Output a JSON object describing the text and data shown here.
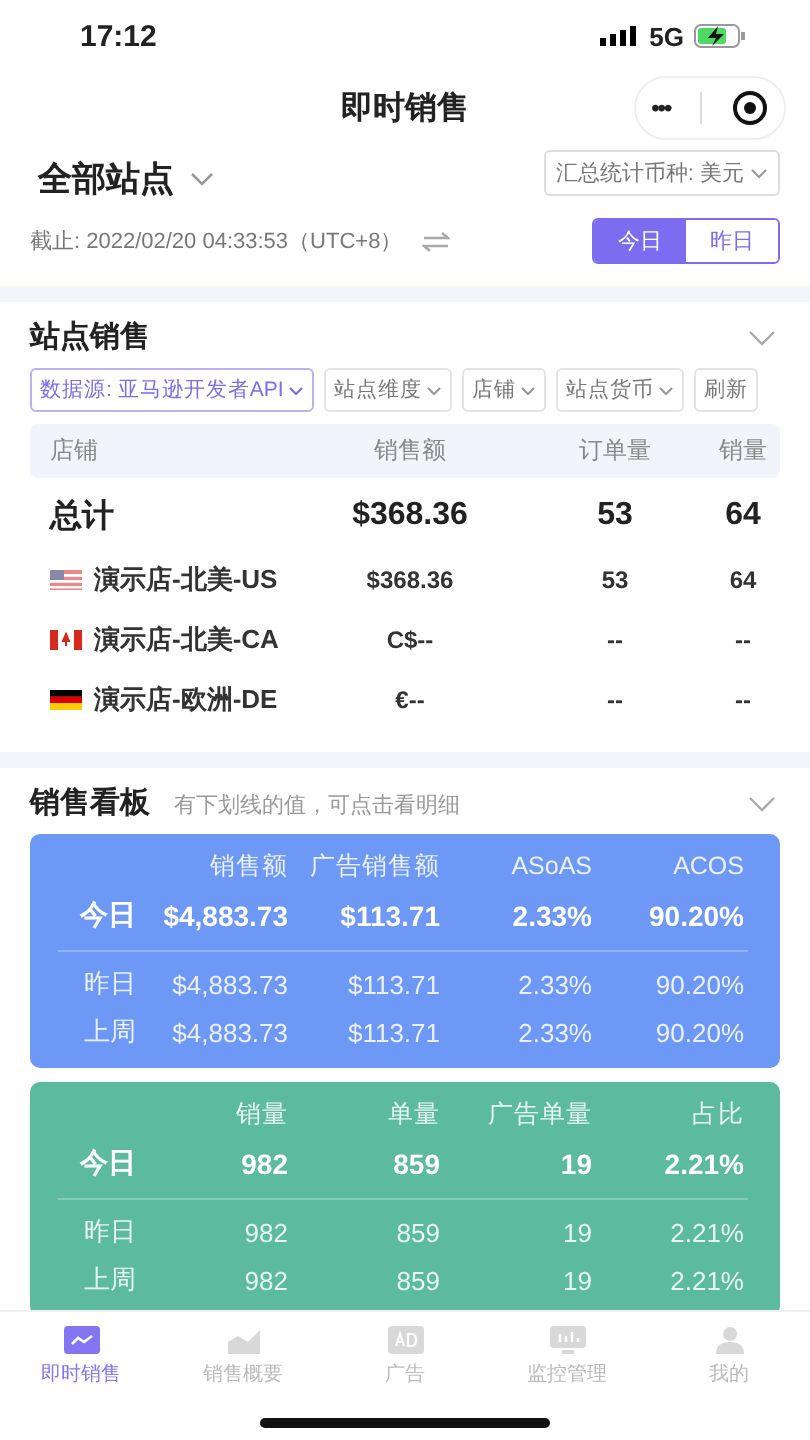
{
  "status_bar": {
    "time": "17:12",
    "network": "5G"
  },
  "nav": {
    "title": "即时销售",
    "more": "•••"
  },
  "header": {
    "station": "全部站点",
    "currency": "汇总统计币种: 美元",
    "cutoff": "截止: 2022/02/20 04:33:53（UTC+8）",
    "range": [
      {
        "label": "今日",
        "selected": true
      },
      {
        "label": "昨日",
        "selected": false
      }
    ]
  },
  "site_sales": {
    "title": "站点销售",
    "filters": [
      {
        "label": "数据源: 亚马逊开发者API",
        "dropdown": true,
        "selected": true
      },
      {
        "label": "站点维度",
        "dropdown": true,
        "selected": false
      },
      {
        "label": "店铺",
        "dropdown": true,
        "selected": false
      },
      {
        "label": "站点货币",
        "dropdown": true,
        "selected": false
      },
      {
        "label": "刷新",
        "dropdown": false,
        "selected": false
      }
    ],
    "columns": [
      "店铺",
      "销售额",
      "订单量",
      "销量"
    ],
    "rows": [
      {
        "kind": "total",
        "cells": [
          "总计",
          "$368.36",
          "53",
          "64"
        ]
      },
      {
        "kind": "store",
        "flag": {
          "kind": "us"
        },
        "cells": [
          "演示店-北美-US",
          "$368.36",
          "53",
          "64"
        ]
      },
      {
        "kind": "store",
        "flag": {
          "kind": "ca"
        },
        "cells": [
          "演示店-北美-CA",
          "C$--",
          "--",
          "--"
        ]
      },
      {
        "kind": "store",
        "flag": {
          "kind": "de"
        },
        "cells": [
          "演示店-欧洲-DE",
          "€--",
          "--",
          "--"
        ]
      }
    ]
  },
  "dashboard": {
    "title": "销售看板",
    "hint": "有下划线的值，可点击看明细",
    "cards": [
      {
        "color": "#6e98f5",
        "columns": [
          "销售额",
          "广告销售额",
          "ASoAS",
          "ACOS"
        ],
        "rows": [
          {
            "label": "今日",
            "highlighted": true,
            "values": [
              "$4,883.73",
              "$113.71",
              "2.33%",
              "90.20%"
            ]
          },
          {
            "label": "昨日",
            "highlighted": false,
            "values": [
              "$4,883.73",
              "$113.71",
              "2.33%",
              "90.20%"
            ]
          },
          {
            "label": "上周",
            "highlighted": false,
            "values": [
              "$4,883.73",
              "$113.71",
              "2.33%",
              "90.20%"
            ]
          }
        ]
      },
      {
        "color": "#5cbb9e",
        "columns": [
          "销量",
          "单量",
          "广告单量",
          "占比"
        ],
        "rows": [
          {
            "label": "今日",
            "highlighted": true,
            "values": [
              "982",
              "859",
              "19",
              "2.21%"
            ]
          },
          {
            "label": "昨日",
            "highlighted": false,
            "values": [
              "982",
              "859",
              "19",
              "2.21%"
            ]
          },
          {
            "label": "上周",
            "highlighted": false,
            "values": [
              "982",
              "859",
              "19",
              "2.21%"
            ]
          }
        ]
      }
    ]
  },
  "tab_bar": [
    {
      "label": "即时销售",
      "kind": "line",
      "selected": true
    },
    {
      "label": "销售概要",
      "kind": "area",
      "selected": false
    },
    {
      "label": "广告",
      "kind": "ad",
      "selected": false
    },
    {
      "label": "监控管理",
      "kind": "monitor",
      "selected": false
    },
    {
      "label": "我的",
      "kind": "person",
      "selected": false
    }
  ]
}
